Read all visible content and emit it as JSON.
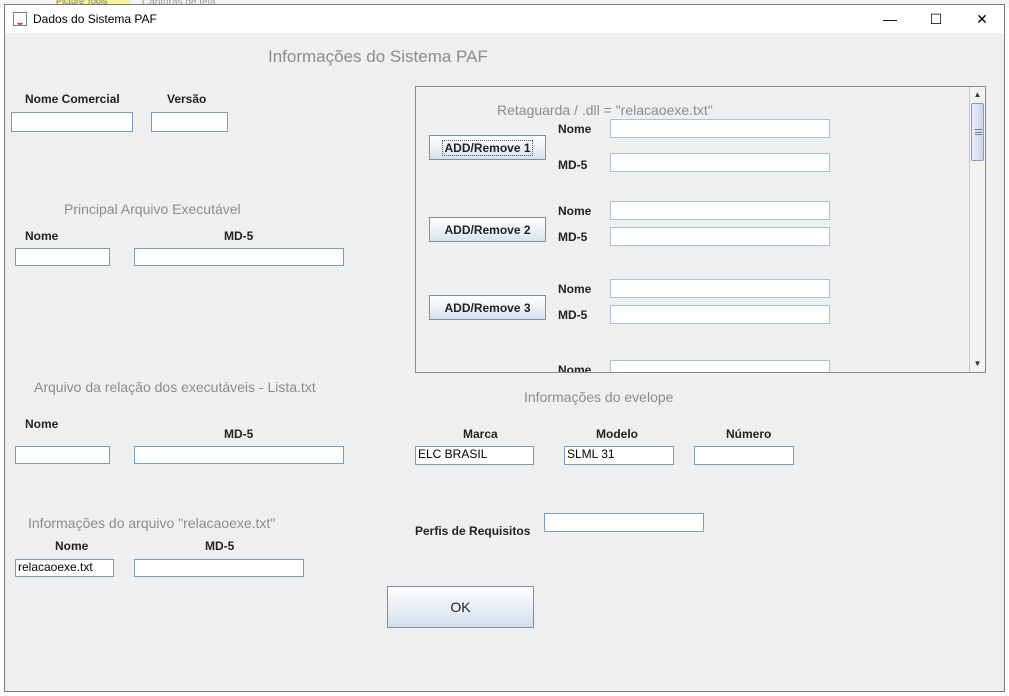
{
  "background": {
    "tab1_label": "Picture Tools",
    "tab2_label": "Capturas de tela"
  },
  "window": {
    "title": "Dados do Sistema PAF",
    "minimize_symbol": "—",
    "maximize_symbol": "☐",
    "close_symbol": "✕",
    "icon": "java-icon"
  },
  "header": {
    "title": "Informações do Sistema PAF"
  },
  "commercial": {
    "nome_label": "Nome Comercial",
    "versao_label": "Versão",
    "nome_value": "",
    "versao_value": ""
  },
  "principal": {
    "section_title": "Principal Arquivo Executável",
    "nome_label": "Nome",
    "md5_label": "MD-5",
    "nome_value": "",
    "md5_value": ""
  },
  "lista": {
    "section_title": "Arquivo da relação dos executáveis - Lista.txt",
    "nome_label": "Nome",
    "md5_label": "MD-5",
    "nome_value": "",
    "md5_value": ""
  },
  "relacao": {
    "section_title": "Informações do arquivo \"relacaoexe.txt\"",
    "nome_label": "Nome",
    "md5_label": "MD-5",
    "nome_value": "relacaoexe.txt",
    "md5_value": ""
  },
  "retaguarda": {
    "title": "Retaguarda / .dll = \"relacaoexe.txt\"",
    "nome_label": "Nome",
    "md5_label": "MD-5",
    "buttons": [
      "ADD/Remove 1",
      "ADD/Remove 2",
      "ADD/Remove 3"
    ],
    "scroll_up": "▲",
    "scroll_down": "▼"
  },
  "envelope": {
    "section_title": "Informações do evelope",
    "marca_label": "Marca",
    "modelo_label": "Modelo",
    "numero_label": "Número",
    "marca_value": "ELC BRASIL",
    "modelo_value": "SLML 31",
    "numero_value": "",
    "perfis_label": "Perfis de Requisitos",
    "perfis_value": ""
  },
  "ok_label": "OK",
  "colors": {
    "window_bg": "#efefef",
    "field_border": "#7a9cbd",
    "gray_label": "#8c8c8c"
  }
}
